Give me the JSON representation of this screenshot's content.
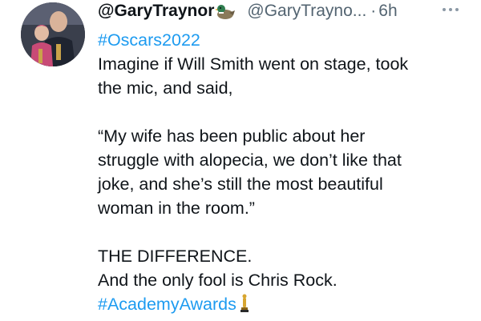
{
  "tweet": {
    "display_name": "@GaryTraynor",
    "name_emoji_icon": "duck-emoji-icon",
    "handle": "@GaryTrayno...",
    "separator": "·",
    "time": "6h",
    "more_icon": "more-horizontal-icon",
    "lines": [
      {
        "text": "#Oscars2022",
        "hashtag": true
      },
      {
        "text": "Imagine if Will Smith went on stage, took",
        "hashtag": false
      },
      {
        "text": "the mic, and said,",
        "hashtag": false
      },
      {
        "blank": true
      },
      {
        "text": "“My wife has been public about her",
        "hashtag": false
      },
      {
        "text": "struggle with alopecia, we don’t like that",
        "hashtag": false
      },
      {
        "text": "joke, and she’s still the most beautiful",
        "hashtag": false
      },
      {
        "text": "woman in the room.”",
        "hashtag": false
      },
      {
        "blank": true
      },
      {
        "text": "THE DIFFERENCE.",
        "hashtag": false
      },
      {
        "text": "And the only fool is Chris Rock.",
        "hashtag": false
      },
      {
        "text": "#AcademyAwards",
        "hashtag": true,
        "trailing_emoji": "oscar-trophy-icon"
      }
    ],
    "colors": {
      "text": "#0f1419",
      "muted": "#536471",
      "hashtag": "#1d9bf0"
    }
  }
}
